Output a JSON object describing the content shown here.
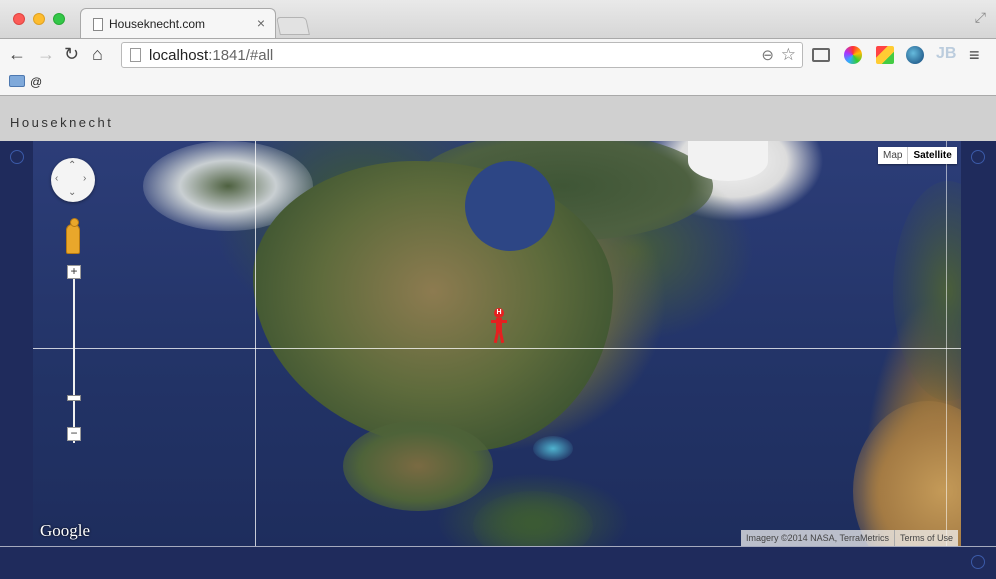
{
  "browser": {
    "tab_title": "Houseknecht.com",
    "tab_close": "×",
    "url_host": "localhost",
    "url_rest": ":1841/#all",
    "bookmark_label": "@",
    "nav": {
      "back": "←",
      "forward": "→",
      "reload": "↻",
      "home": "⌂"
    },
    "icons": {
      "zoom": "⊖",
      "star": "☆",
      "menu": "≡",
      "fullscreen": "⤢",
      "jb": "JB"
    }
  },
  "app": {
    "title": "Houseknecht"
  },
  "map": {
    "map_type_options": [
      "Map",
      "Satellite"
    ],
    "active_map_type": "Satellite",
    "zoom_in_label": "+",
    "zoom_out_label": "−",
    "marker_label": "H",
    "logo_text": "Google",
    "attribution": "Imagery ©2014 NASA, TerraMetrics",
    "terms": "Terms of Use",
    "pan_glyphs": {
      "up": "⌃",
      "down": "⌄",
      "left": "‹",
      "right": "›"
    }
  },
  "colors": {
    "page_background": "#1e2a5a",
    "header_background": "#d0d0d0",
    "marker": "#e52020"
  }
}
